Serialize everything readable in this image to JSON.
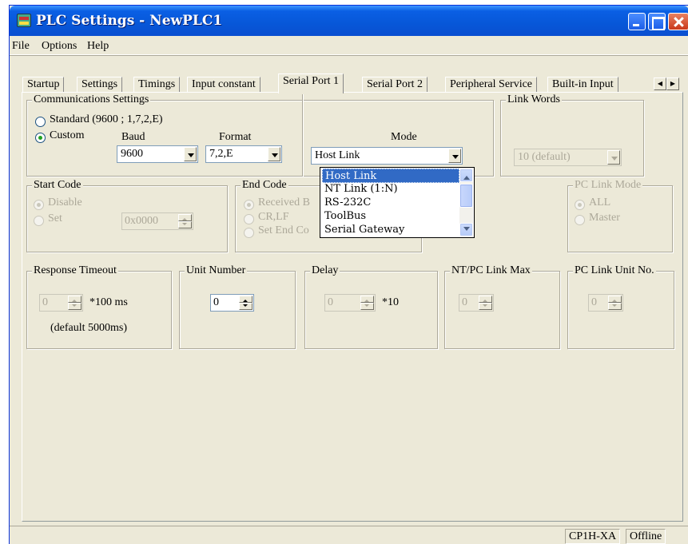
{
  "window": {
    "title": "PLC Settings - NewPLC1"
  },
  "menu": [
    "File",
    "Options",
    "Help"
  ],
  "tabs": [
    "Startup",
    "Settings",
    "Timings",
    "Input constant",
    "Serial Port 1",
    "Serial Port 2",
    "Peripheral Service",
    "Built-in Input"
  ],
  "active_tab": "Serial Port 1",
  "comm": {
    "label": "Communications Settings",
    "standard_label": "Standard (9600 ; 1,7,2,E)",
    "custom_label": "Custom",
    "selected": "Custom",
    "baud_label": "Baud",
    "baud_value": "9600",
    "format_label": "Format",
    "format_value": "7,2,E",
    "mode_label": "Mode",
    "mode_value": "Host Link"
  },
  "link_words": {
    "label": "Link Words",
    "value": "10 (default)"
  },
  "mode_dropdown": {
    "options": [
      "Host Link",
      "NT Link (1:N)",
      "RS-232C",
      "ToolBus",
      "Serial Gateway"
    ],
    "highlighted": "Host Link"
  },
  "start_code": {
    "label": "Start Code",
    "disable_label": "Disable",
    "set_label": "Set",
    "value": "0x0000"
  },
  "end_code": {
    "label": "End Code",
    "received_label": "Received B",
    "crlf_label": "CR,LF",
    "set_end_label": "Set End Co"
  },
  "pc_link_mode": {
    "label": "PC Link Mode",
    "all_label": "ALL",
    "master_label": "Master"
  },
  "response_timeout": {
    "label": "Response Timeout",
    "value": "0",
    "unit": "*100 ms",
    "note": "(default 5000ms)"
  },
  "unit_number": {
    "label": "Unit Number",
    "value": "0"
  },
  "delay": {
    "label": "Delay",
    "value": "0",
    "unit": "*10"
  },
  "nt_pc_link_max": {
    "label": "NT/PC Link Max",
    "value": "0"
  },
  "pc_link_unit_no": {
    "label": "PC Link Unit No.",
    "value": "0"
  },
  "status": {
    "model": "CP1H-XA",
    "state": "Offline"
  }
}
